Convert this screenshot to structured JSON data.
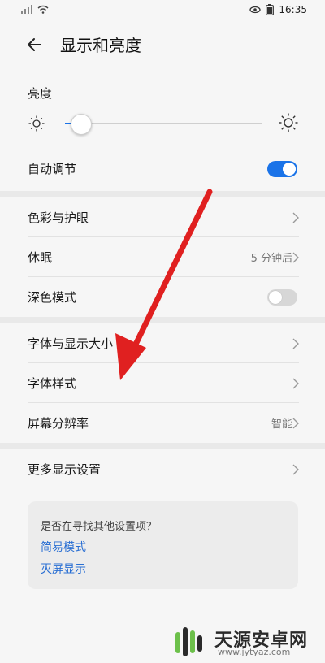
{
  "status_bar": {
    "time": "16:35"
  },
  "header": {
    "title": "显示和亮度"
  },
  "brightness": {
    "label": "亮度",
    "level": 0.08
  },
  "auto_adjust": {
    "label": "自动调节",
    "on": true
  },
  "group1": [
    {
      "label": "色彩与护眼",
      "value": ""
    },
    {
      "label": "休眠",
      "value": "5 分钟后"
    },
    {
      "label": "深色模式",
      "toggle": false
    }
  ],
  "group2": [
    {
      "label": "字体与显示大小",
      "value": ""
    },
    {
      "label": "字体样式",
      "value": ""
    },
    {
      "label": "屏幕分辨率",
      "value": "智能"
    }
  ],
  "more": {
    "label": "更多显示设置"
  },
  "suggest": {
    "question": "是否在寻找其他设置项？",
    "links": [
      "简易模式",
      "灭屏显示"
    ]
  },
  "watermark": {
    "name": "天源安卓网",
    "url": "www.jytyaz.com"
  },
  "colors": {
    "accent": "#1a73e8",
    "annotation_arrow": "#e02020"
  }
}
